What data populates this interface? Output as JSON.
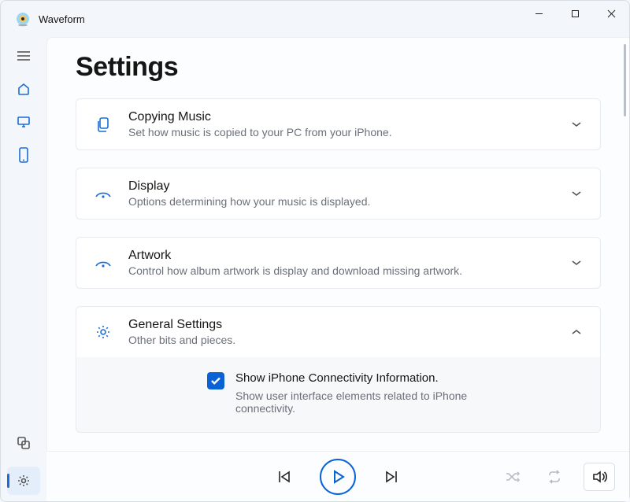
{
  "app": {
    "name": "Waveform"
  },
  "page": {
    "title": "Settings"
  },
  "sections": {
    "copying": {
      "title": "Copying Music",
      "sub": "Set how music is copied to your PC from your iPhone."
    },
    "display": {
      "title": "Display",
      "sub": "Options determining how your music is displayed."
    },
    "artwork": {
      "title": "Artwork",
      "sub": "Control how album artwork is display and download missing artwork."
    },
    "general": {
      "title": "General Settings",
      "sub": "Other bits and pieces."
    }
  },
  "general_option": {
    "label": "Show iPhone Connectivity Information.",
    "desc": "Show user interface elements related to iPhone connectivity.",
    "checked": true
  }
}
